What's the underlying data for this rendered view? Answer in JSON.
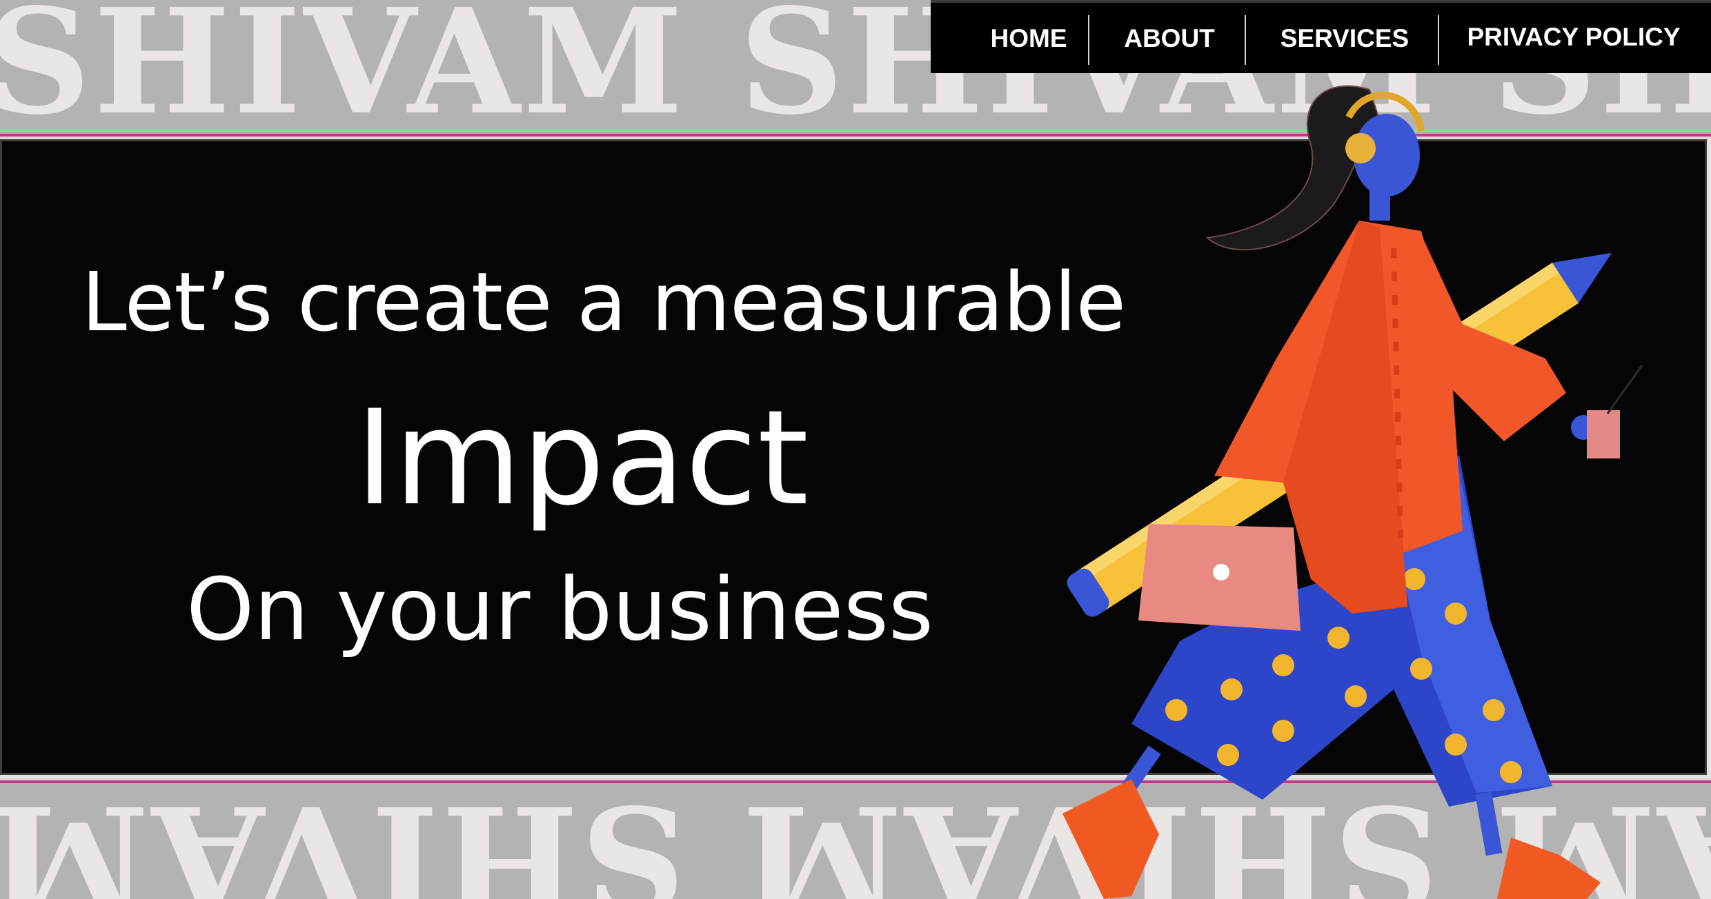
{
  "brand": {
    "wordmark": "SHIVAM SHIVAM SHIVAM SHIVAM"
  },
  "nav": {
    "items": [
      {
        "label": "HOME"
      },
      {
        "label": "ABOUT"
      },
      {
        "label": "SERVICES"
      },
      {
        "label": "PRIVACY POLICY"
      }
    ]
  },
  "hero": {
    "line1": "Let’s create a measurable",
    "line2": "Impact",
    "line3": "On your business"
  },
  "colors": {
    "banner_gray": "#b3b3b3",
    "hero_bg": "#050505",
    "nav_bg": "#000000",
    "coat_orange": "#f2572a",
    "pants_blue": "#2d46c9",
    "dot_yellow": "#f1b62e",
    "pencil_yellow": "#f7c23a"
  }
}
